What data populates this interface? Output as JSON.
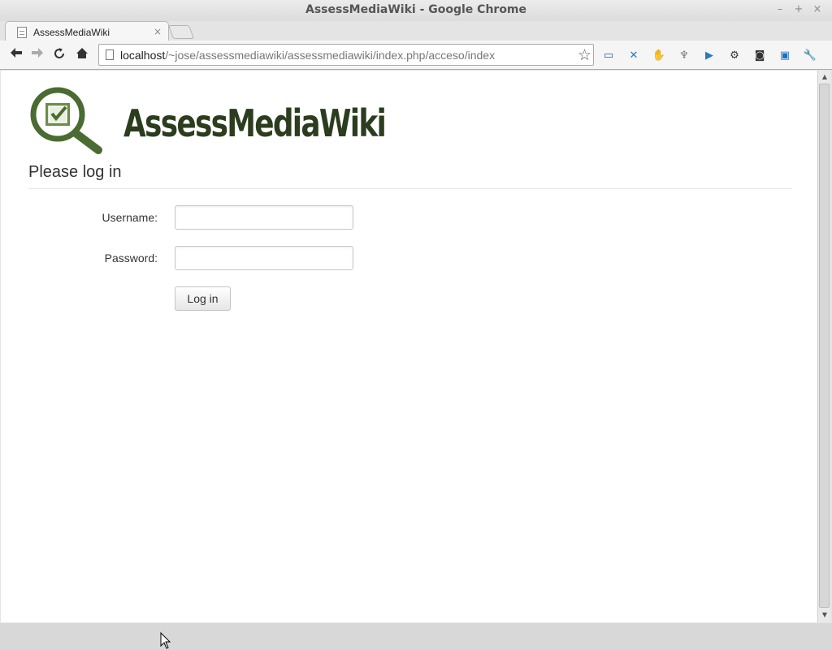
{
  "window": {
    "title": "AssessMediaWiki - Google Chrome",
    "controls": {
      "minimize": "–",
      "maximize": "+",
      "close": "×"
    }
  },
  "tabs": [
    {
      "title": "AssessMediaWiki",
      "close": "×"
    }
  ],
  "toolbar": {
    "back": "🡐",
    "forward": "🡒",
    "reload": "↻",
    "home": "⌂",
    "url_host": "localhost",
    "url_path": "/~jose/assessmediawiki/assessmediawiki/index.php/acceso/index",
    "star": "☆",
    "extensions": [
      {
        "icon": "screenshot-icon",
        "glyph": "▭",
        "color": "#2a5fa0"
      },
      {
        "icon": "bookmark-manager-icon",
        "glyph": "✕",
        "color": "#1f7bbf"
      },
      {
        "icon": "adblock-icon",
        "glyph": "✋",
        "color": "#cc2a1e"
      },
      {
        "icon": "plant-icon",
        "glyph": "♆",
        "color": "#777777"
      },
      {
        "icon": "play-icon",
        "glyph": "▶",
        "color": "#2b7bb6"
      },
      {
        "icon": "gear-icon",
        "glyph": "⚙",
        "color": "#333333"
      },
      {
        "icon": "evernote-icon",
        "glyph": "◙",
        "color": "#333333"
      },
      {
        "icon": "photos-icon",
        "glyph": "▣",
        "color": "#1f6fc2"
      },
      {
        "icon": "wrench-icon",
        "glyph": "🔧",
        "color": "#444444"
      }
    ]
  },
  "page": {
    "logo_text": "AssessMediaWiki",
    "heading": "Please log in",
    "form": {
      "username_label": "Username:",
      "username_value": "",
      "password_label": "Password:",
      "password_value": "",
      "submit_label": "Log in"
    }
  },
  "colors": {
    "logo_green": "#4a6b31",
    "logo_text": "#2b3d1e",
    "check_bg": "#6b8f45"
  }
}
